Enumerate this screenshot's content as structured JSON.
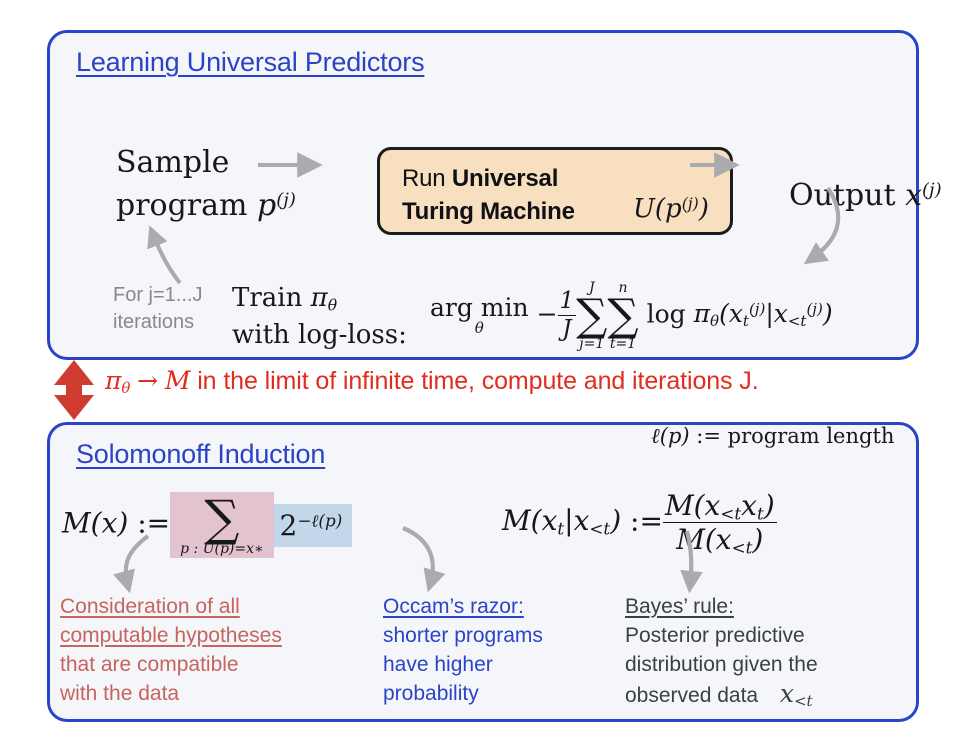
{
  "figure": {
    "background": "#ffffff",
    "panel_fill": "#f4f6f9",
    "panel_border": "#2b44c7",
    "utm_fill": "#f7dfc0",
    "highlight_sum": "#e3c3cf",
    "highlight_power": "#c3d7ea",
    "accent_red": "#e02d20",
    "caption_rose": "#c7645f",
    "caption_blue": "#2b44c7",
    "caption_gray": "#3c3f44",
    "arrow_gray": "#a9abae"
  },
  "top_panel": {
    "title": "Learning Universal Predictors",
    "sample_label_line1": "Sample",
    "sample_label_line2_text": "program",
    "sample_label_line2_math": "p(j)",
    "utm": {
      "prefix": "Run",
      "bold_line1": "Universal",
      "bold_line2": "Turing Machine",
      "math": "U(p(j))"
    },
    "output_label_text": "Output",
    "output_label_math": "x(j)",
    "loop_note_line1": "For j=1...J",
    "loop_note_line2": "iterations",
    "train_line1_text": "Train",
    "train_line1_math": "πθ",
    "train_line2": "with log-loss:",
    "formula": {
      "argmin_top": "arg min",
      "argmin_bottom": "θ",
      "minus": "−",
      "frac_num": "1",
      "frac_den": "J",
      "sum1_top": "J",
      "sum1_symbol": "∑",
      "sum1_bottom": "j=1",
      "sum2_top": "n",
      "sum2_symbol": "∑",
      "sum2_bottom": "t=1",
      "log": "log",
      "pi_theta": "πθ",
      "arg_numerator": "xt(j)",
      "arg_conditional": "x<t(j)"
    }
  },
  "middle_band": {
    "arrow_icon": "double-headed-vertical-arrow",
    "math_lhs": "πθ",
    "arrow_symbol": "→",
    "math_rhs": "M",
    "text": "in the limit of infinite time, compute and iterations J."
  },
  "bottom_panel": {
    "title": "Solomonoff Induction",
    "length_definition": {
      "symbol": "ℓ(p)",
      "assign": ":=",
      "text": "program length"
    },
    "m_formula": {
      "lhs": "M(x)",
      "assign": ":=",
      "sum_symbol": "∑",
      "sum_subscript": "p : U(p)=x∗",
      "term": "2−ℓ(p)"
    },
    "conditional_formula": {
      "lhs": "M(xt|x<t)",
      "assign": ":=",
      "numerator": "M(x<t xt)",
      "denominator": "M(x<t)"
    },
    "captions": [
      {
        "id": "consideration",
        "underlined_line1": "Consideration of all",
        "underlined_line2": "computable hypotheses",
        "rest_line1": "that are compatible",
        "rest_line2": "with the data",
        "color": "#c7645f"
      },
      {
        "id": "occam",
        "underlined_line1": "Occam’s razor:",
        "rest_line1": "shorter programs",
        "rest_line2": "have higher",
        "rest_line3": "probability",
        "color": "#2b44c7"
      },
      {
        "id": "bayes",
        "underlined_line1": "Bayes’ rule:",
        "rest_line1": "Posterior predictive",
        "rest_line2": "distribution given the",
        "rest_line3": "observed data",
        "trailing_math": "x<t",
        "color": "#3c3f44"
      }
    ]
  }
}
